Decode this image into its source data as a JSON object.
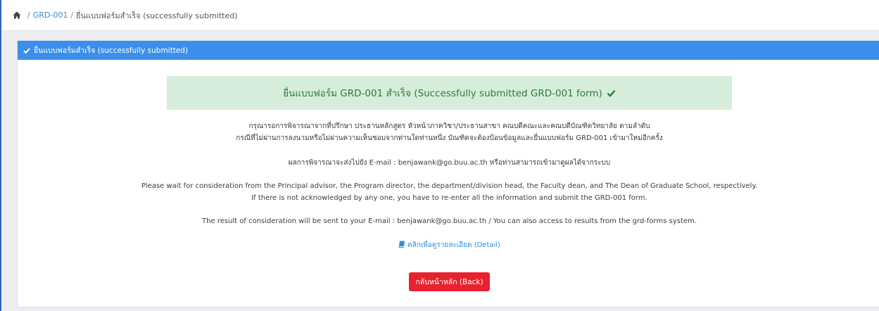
{
  "breadcrumb": {
    "home_icon": "home-icon",
    "separator": "/",
    "link_label": "GRD-001",
    "current_label": "ยื่นแบบฟอร์มสำเร็จ (successfully submitted)"
  },
  "card": {
    "header_icon": "check-icon",
    "header_title": "ยื่นแบบฟอร์มสำเร็จ (successfully submitted)",
    "header_color": "#3b8fea",
    "success_message": "ยื่นแบบฟอร์ม GRD-001 สำเร็จ (Successfully submitted GRD-001 form)",
    "success_icon": "check-icon",
    "success_bg": "#d6eddc",
    "success_color": "#2f7a36",
    "thai_wait_line1": "กรุณารอการพิจารณาจากที่ปรึกษา ประธานหลักสูตร หัวหน้าภาควิชา/ประธานสาขา คณบดีคณะและคณบดีบัณฑิตวิทยาลัย ตามลำดับ",
    "thai_wait_line2": "กรณีที่ไม่ผ่านการลงนามหรือไม่ผ่านความเห็นชอบจากท่านใดท่านหนึ่ง บัณฑิตจะต้องป้อนข้อมูลและยื่นแบบฟอร์ม GRD-001 เข้ามาใหม่อีกครั้ง",
    "thai_result_line": "ผลการพิจารณาจะส่งไปยัง E-mail : benjawank@go.buu.ac.th หรือท่านสามารถเข้ามาดูผลได้จากระบบ",
    "en_wait_line1": "Please wait for consideration from the Principal advisor, the Program director, the department/division head, the Faculty dean, and The Dean of Graduate School, respectively.",
    "en_wait_line2": "If there is not acknowledged by any one, you have to re-enter all the information and submit the GRD-001 form.",
    "en_result_line": "The result of consideration will be sent to your E-mail : benjawank@go.buu.ac.th / You can also access to results from the grd-forms system.",
    "detail_icon": "book-icon",
    "detail_link": "คลิกเพื่อดูรายละเอียด (Detail)",
    "back_button": "กลับหน้าหลัก (Back)",
    "back_color": "#e8212f"
  }
}
